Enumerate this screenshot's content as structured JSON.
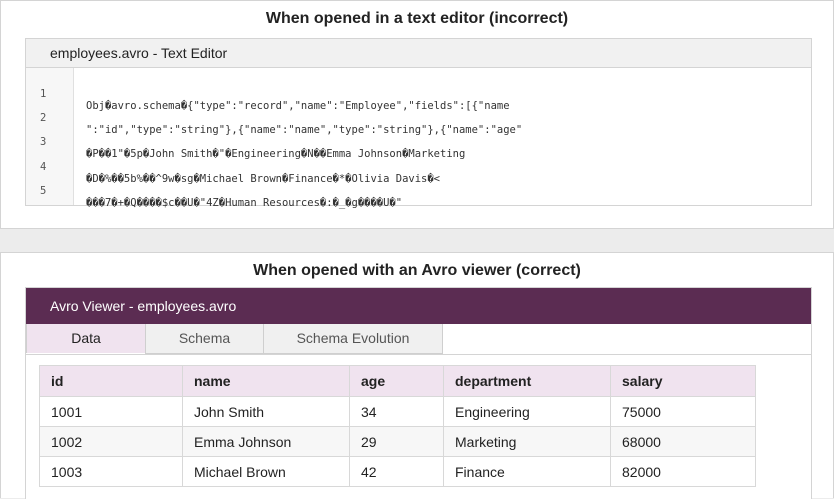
{
  "editor_section": {
    "title": "When opened in a text editor (incorrect)",
    "window_title": "employees.avro - Text Editor",
    "lines": [
      {
        "number": "1",
        "text": "Obj�avro.schema�{\"type\":\"record\",\"name\":\"Employee\",\"fields\":[{\"name"
      },
      {
        "number": "2",
        "text": "\":\"id\",\"type\":\"string\"},{\"name\":\"name\",\"type\":\"string\"},{\"name\":\"age\""
      },
      {
        "number": "3",
        "text": "�P��1\"�5p�John Smith�\"�Engineering�N��Emma Johnson�Marketing"
      },
      {
        "number": "4",
        "text": "�D�%��5b%��^9w�sg�Michael Brown�Finance�*�Olivia Davis�<"
      },
      {
        "number": "5",
        "text": "���7�+�Q����$c��U�\"4Z�Human Resources�:�_�g����U�\""
      }
    ]
  },
  "viewer_section": {
    "title": "When opened with an Avro viewer (correct)",
    "window_title": "Avro Viewer - employees.avro",
    "tabs": [
      {
        "label": "Data",
        "active": true
      },
      {
        "label": "Schema",
        "active": false
      },
      {
        "label": "Schema Evolution",
        "active": false
      }
    ],
    "table": {
      "columns": [
        "id",
        "name",
        "age",
        "department",
        "salary"
      ],
      "rows": [
        [
          "1001",
          "John Smith",
          "34",
          "Engineering",
          "75000"
        ],
        [
          "1002",
          "Emma Johnson",
          "29",
          "Marketing",
          "68000"
        ],
        [
          "1003",
          "Michael Brown",
          "42",
          "Finance",
          "82000"
        ]
      ]
    }
  },
  "colors": {
    "viewer_titlebar": "#5b2c52",
    "active_tab": "#f0e3ef",
    "table_header": "#f0e3ef"
  }
}
